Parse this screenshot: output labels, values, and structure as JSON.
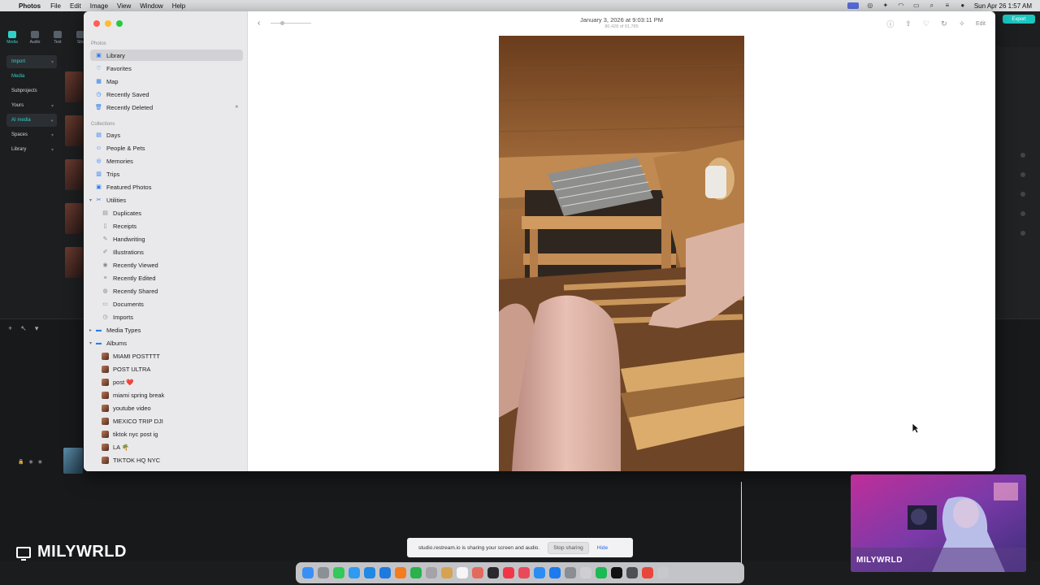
{
  "menubar": {
    "app_name": "Photos",
    "menus": [
      "File",
      "Edit",
      "Image",
      "View",
      "Window",
      "Help"
    ],
    "clock": "Sun Apr 26  1:57 AM"
  },
  "editor": {
    "tools": [
      "Media",
      "Audio",
      "Text",
      "Stic"
    ],
    "nav": [
      "Import",
      "Media",
      "Subprojects",
      "Yours",
      "AI media",
      "Spaces",
      "Library"
    ],
    "export_label": "Export",
    "accent": "#1bc7c1"
  },
  "photos": {
    "sections": {
      "photos": "Photos",
      "collections": "Collections"
    },
    "library_items": [
      "Library",
      "Favorites",
      "Map",
      "Recently Saved",
      "Recently Deleted"
    ],
    "collection_items": [
      "Days",
      "People & Pets",
      "Memories",
      "Trips",
      "Featured Photos",
      "Utilities"
    ],
    "utility_items": [
      "Duplicates",
      "Receipts",
      "Handwriting",
      "Illustrations",
      "Recently Viewed",
      "Recently Edited",
      "Recently Shared",
      "Documents",
      "Imports"
    ],
    "media_types_label": "Media Types",
    "albums_label": "Albums",
    "albums": [
      "MIAMI POSTTTT",
      "POST ULTRA",
      "post ❤️",
      "miami spring break",
      "youtube video",
      "MEXICO TRIP DJI",
      "tiktok nyc post ig",
      "LA 🌴",
      "TIKTOK HQ NYC"
    ],
    "toolbar": {
      "date": "January 3, 2026 at 9:03:11 PM",
      "count": "80,428 of 91,785",
      "edit_label": "Edit"
    },
    "selection_color": "#d2d2d6",
    "icon_color": "#2a7cf2"
  },
  "share_bar": {
    "message": "studio.restream.io is sharing your screen and audio.",
    "stop_label": "Stop sharing",
    "hide_label": "Hide"
  },
  "watermark": {
    "name": "MILYWRLD"
  },
  "webcam": {
    "name": "MILYWRLD"
  }
}
